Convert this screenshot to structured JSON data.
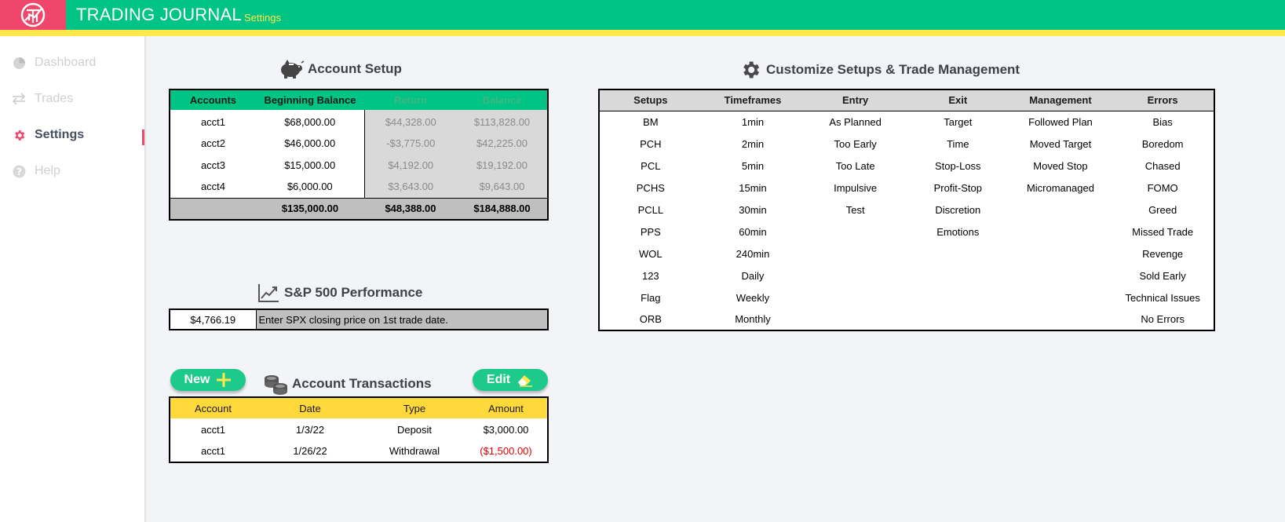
{
  "header": {
    "title": "TRADING JOURNAL",
    "subtitle": "Settings",
    "logo_icon": "trading-logo-icon"
  },
  "colors": {
    "brand_green": "#00c484",
    "accent_yellow": "#ffe74c",
    "logo_pink": "#f0466b",
    "negative_red": "#e00000"
  },
  "sidebar": {
    "items": [
      {
        "label": "Dashboard",
        "icon": "pie-chart-icon"
      },
      {
        "label": "Trades",
        "icon": "swap-arrows-icon"
      },
      {
        "label": "Settings",
        "icon": "gear-icon"
      },
      {
        "label": "Help",
        "icon": "question-icon"
      }
    ],
    "active": "Settings"
  },
  "account_setup": {
    "title": "Account Setup",
    "icon": "piggy-bank-icon",
    "headers": [
      "Accounts",
      "Beginning Balance",
      "Return",
      "Balance"
    ],
    "rows": [
      [
        "acct1",
        "$68,000.00",
        "$44,328.00",
        "$113,828.00"
      ],
      [
        "acct2",
        "$46,000.00",
        "-$3,775.00",
        "$42,225.00"
      ],
      [
        "acct3",
        "$15,000.00",
        "$4,192.00",
        "$19,192.00"
      ],
      [
        "acct4",
        "$6,000.00",
        "$3,643.00",
        "$9,643.00"
      ]
    ],
    "totals": [
      "",
      "$135,000.00",
      "$48,388.00",
      "$184,888.00"
    ]
  },
  "sp500": {
    "title": "S&P 500 Performance",
    "icon": "trend-chart-icon",
    "price": "$4,766.19",
    "note": "Enter SPX closing price on 1st trade date."
  },
  "transactions": {
    "title": "Account Transactions",
    "icon": "coins-icon",
    "new_label": "New",
    "edit_label": "Edit",
    "headers": [
      "Account",
      "Date",
      "Type",
      "Amount"
    ],
    "rows": [
      [
        "acct1",
        "1/3/22",
        "Deposit",
        "$3,000.00"
      ],
      [
        "acct1",
        "1/26/22",
        "Withdrawal",
        "($1,500.00)"
      ]
    ]
  },
  "customize": {
    "title": "Customize Setups & Trade Management",
    "icon": "gear-icon",
    "headers": [
      "Setups",
      "Timeframes",
      "Entry",
      "Exit",
      "Management",
      "Errors"
    ],
    "rows": [
      [
        "BM",
        "1min",
        "As Planned",
        "Target",
        "Followed Plan",
        "Bias"
      ],
      [
        "PCH",
        "2min",
        "Too Early",
        "Time",
        "Moved Target",
        "Boredom"
      ],
      [
        "PCL",
        "5min",
        "Too Late",
        "Stop-Loss",
        "Moved Stop",
        "Chased"
      ],
      [
        "PCHS",
        "15min",
        "Impulsive",
        "Profit-Stop",
        "Micromanaged",
        "FOMO"
      ],
      [
        "PCLL",
        "30min",
        "Test",
        "Discretion",
        "",
        "Greed"
      ],
      [
        "PPS",
        "60min",
        "",
        "Emotions",
        "",
        "Missed Trade"
      ],
      [
        "WOL",
        "240min",
        "",
        "",
        "",
        "Revenge"
      ],
      [
        "123",
        "Daily",
        "",
        "",
        "",
        "Sold Early"
      ],
      [
        "Flag",
        "Weekly",
        "",
        "",
        "",
        "Technical Issues"
      ],
      [
        "ORB",
        "Monthly",
        "",
        "",
        "",
        "No Errors"
      ]
    ]
  }
}
